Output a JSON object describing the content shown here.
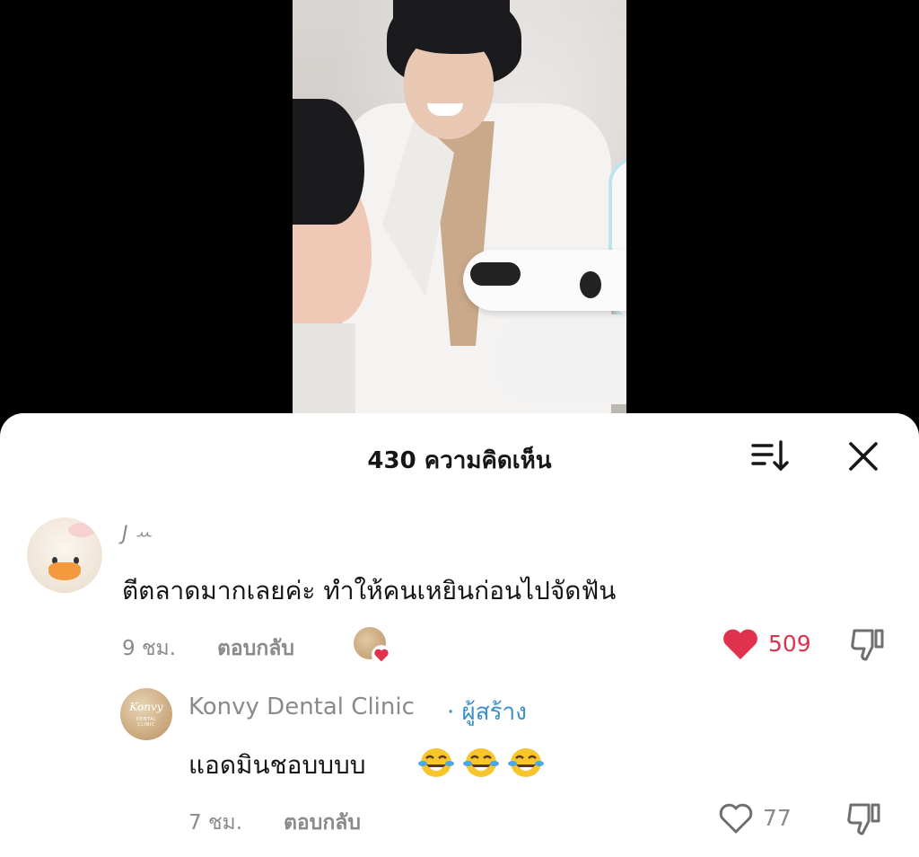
{
  "sheet": {
    "title": "430 ความคิดเห็น",
    "sort_icon": "sort-icon",
    "close_icon": "close-icon"
  },
  "comments": [
    {
      "avatar_icon": "duck-avatar",
      "username": "J ꕀ",
      "text": "ตีตลาดมากเลยค่ะ ทำให้คนเหยินก่อนไปจัดฟัน",
      "time": "9 ชม.",
      "reply_label": "ตอบกลับ",
      "creator_liked": true,
      "likes": "509",
      "liked": true,
      "like_color": "#e1324d"
    },
    {
      "avatar_icon": "konvy-dental-logo",
      "avatar_text": "Konvy",
      "avatar_subtext": "DENTAL CLINIC",
      "username": "Konvy Dental Clinic",
      "creator_label": "· ผู้สร้าง",
      "creator_color": "#3a8fc7",
      "text": "แอดมินชอบบบบ",
      "emojis": [
        "face-with-tears-of-joy",
        "face-with-tears-of-joy",
        "face-with-tears-of-joy"
      ],
      "time": "7 ชม.",
      "reply_label": "ตอบกลับ",
      "likes": "77",
      "liked": false
    }
  ]
}
